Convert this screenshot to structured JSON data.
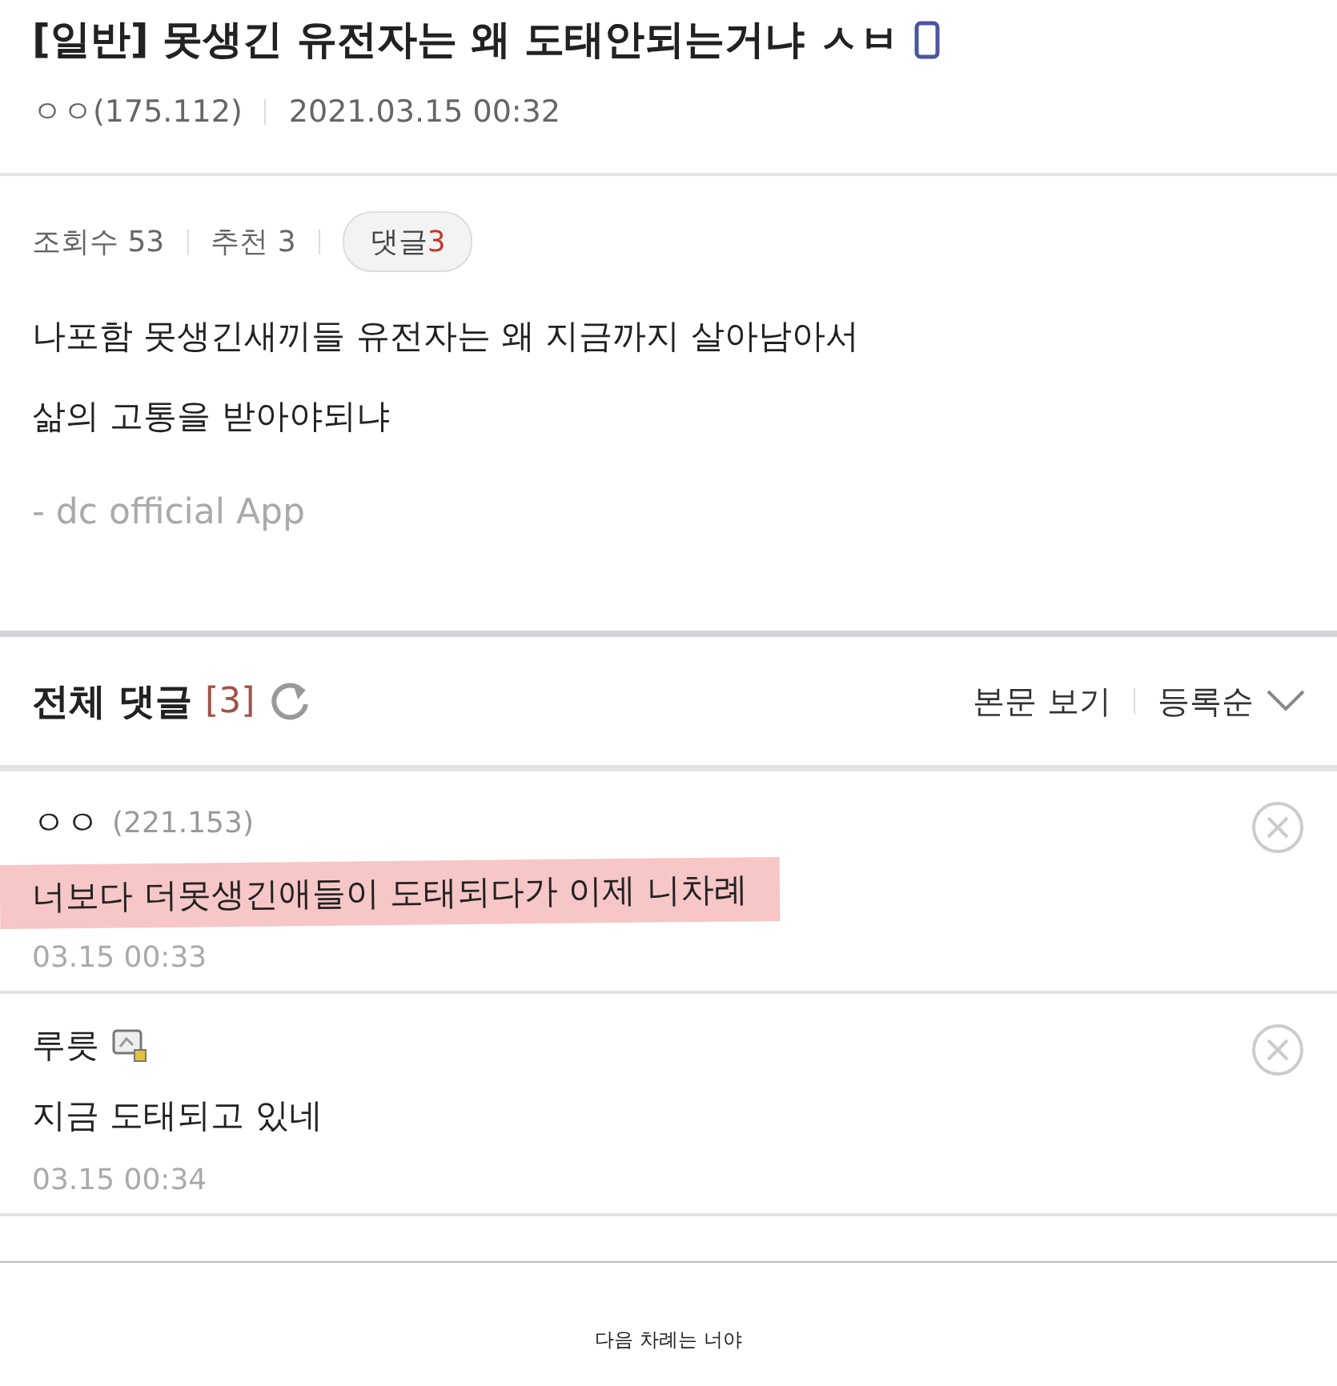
{
  "post": {
    "title": "[일반] 못생긴 유전자는 왜 도태안되는거냐 ㅅㅂ",
    "author": "ㅇㅇ(175.112)",
    "date": "2021.03.15 00:32",
    "views": "조회수 53",
    "likes": "추천 3",
    "comment_label": "댓글",
    "comment_count": "3",
    "body": [
      "나포함 못생긴새끼들 유전자는 왜 지금까지 살아남아서",
      "삶의 고통을 받아야되냐"
    ],
    "signature": "- dc official App"
  },
  "comments_header": {
    "title": "전체 댓글",
    "count": "[3]",
    "view_post": "본문 보기",
    "sort": "등록순"
  },
  "comments": [
    {
      "author": "ㅇㅇ",
      "ip": "(221.153)",
      "text": "너보다 더못생긴애들이 도태되다가 이제 니차례",
      "date": "03.15 00:33",
      "highlighted": true,
      "kind": "guest"
    },
    {
      "author": "루릇",
      "text": "지금 도태되고 있네",
      "date": "03.15 00:34",
      "highlighted": false,
      "kind": "member"
    }
  ],
  "caption": "다음 차례는 너야"
}
